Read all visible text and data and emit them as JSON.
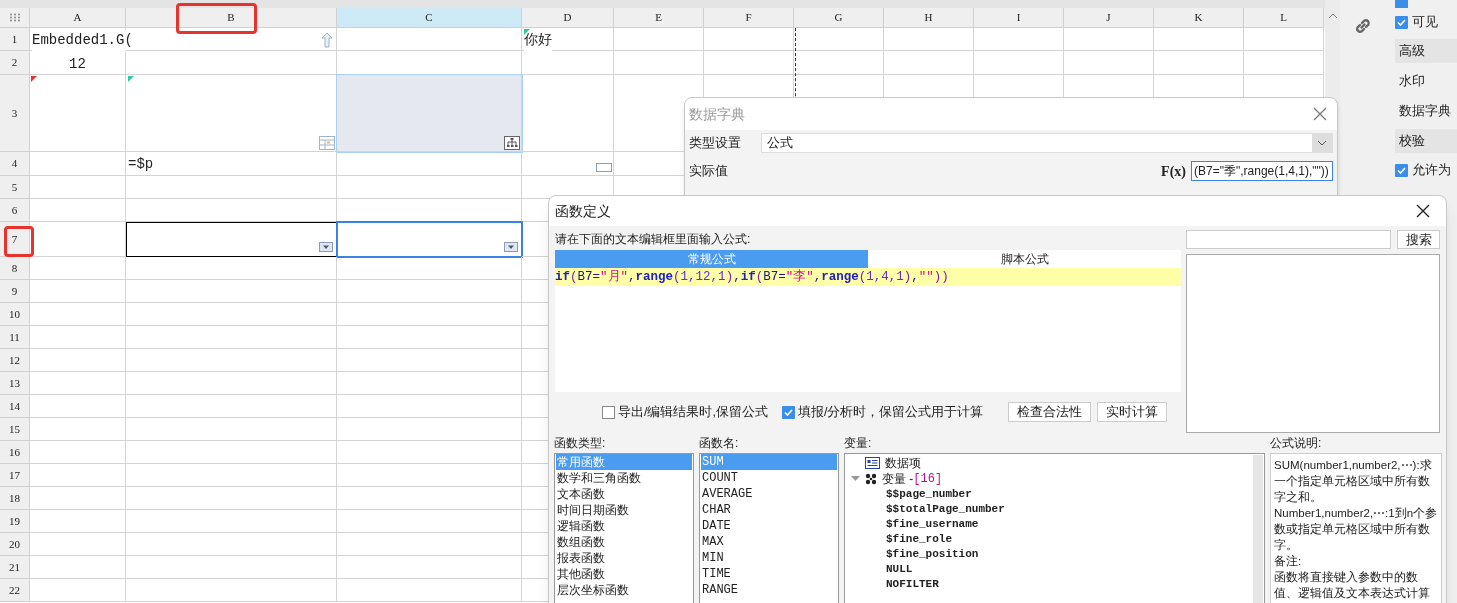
{
  "sheet": {
    "columns": [
      {
        "label": "A",
        "selected": false
      },
      {
        "label": "B",
        "selected": false
      },
      {
        "label": "C",
        "selected": true
      },
      {
        "label": "D",
        "selected": false
      },
      {
        "label": "E",
        "selected": false
      },
      {
        "label": "F",
        "selected": false
      },
      {
        "label": "G",
        "selected": false
      },
      {
        "label": "H",
        "selected": false
      },
      {
        "label": "I",
        "selected": false
      },
      {
        "label": "J",
        "selected": false
      },
      {
        "label": "K",
        "selected": false
      },
      {
        "label": "L",
        "selected": false
      }
    ],
    "rows": [
      {
        "label": "1",
        "cells": [
          {
            "kind": "text",
            "text": "Embedded1.G("
          },
          {
            "kind": "attachment"
          },
          {
            "kind": "blank"
          },
          {
            "kind": "text",
            "text": "你好"
          }
        ]
      },
      {
        "label": "2",
        "cells": [
          {
            "kind": "number",
            "text": "12"
          }
        ]
      },
      {
        "label": "3",
        "cells": [
          {
            "kind": "blank"
          },
          {
            "kind": "subreport"
          },
          {
            "kind": "hierarchy"
          }
        ]
      },
      {
        "label": "4",
        "cells": [
          {
            "kind": "blank"
          },
          {
            "kind": "text",
            "text": "=$p"
          },
          {
            "kind": "blank"
          },
          {
            "kind": "widget"
          }
        ]
      },
      {
        "label": "5"
      },
      {
        "label": "6"
      },
      {
        "label": "7",
        "cells": [
          {
            "kind": "blank"
          },
          {
            "kind": "dropdown",
            "selected": false
          },
          {
            "kind": "dropdown",
            "selected": true
          }
        ]
      },
      {
        "label": "8"
      },
      {
        "label": "9"
      },
      {
        "label": "10"
      },
      {
        "label": "11"
      },
      {
        "label": "12"
      },
      {
        "label": "13"
      },
      {
        "label": "14"
      },
      {
        "label": "15"
      },
      {
        "label": "16"
      },
      {
        "label": "17"
      },
      {
        "label": "18"
      },
      {
        "label": "19"
      },
      {
        "label": "20"
      },
      {
        "label": "21"
      },
      {
        "label": "22"
      }
    ]
  },
  "properties_panel": {
    "items": [
      {
        "kind": "checkbox",
        "label": "可见",
        "checked": true
      },
      {
        "kind": "header",
        "label": "高级"
      },
      {
        "kind": "link",
        "label": "水印"
      },
      {
        "kind": "link",
        "label": "数据字典"
      },
      {
        "kind": "header",
        "label": "校验"
      },
      {
        "kind": "checkbox",
        "label": "允许为",
        "checked": true
      }
    ]
  },
  "data_dictionary_dialog": {
    "title": "数据字典",
    "type_label": "类型设置",
    "type_value": "公式",
    "actual_label": "实际值",
    "fx_label": "F(x)",
    "actual_value": "(B7=\"季\",range(1,4,1),\"\"))"
  },
  "function_dialog": {
    "title": "函数定义",
    "prompt": "请在下面的文本编辑框里面输入公式:",
    "tabs": [
      {
        "label": "常规公式",
        "selected": true
      },
      {
        "label": "脚本公式",
        "selected": false
      }
    ],
    "formula": [
      {
        "kind": "keyword",
        "text": "if"
      },
      {
        "kind": "punct",
        "text": "("
      },
      {
        "kind": "plain",
        "text": "B7="
      },
      {
        "kind": "string",
        "text": "\"月\""
      },
      {
        "kind": "plain",
        "text": ","
      },
      {
        "kind": "keyword",
        "text": "range"
      },
      {
        "kind": "punct",
        "text": "("
      },
      {
        "kind": "number",
        "text": "1,12,1"
      },
      {
        "kind": "punct",
        "text": ")"
      },
      {
        "kind": "plain",
        "text": ","
      },
      {
        "kind": "keyword",
        "text": "if"
      },
      {
        "kind": "punct",
        "text": "("
      },
      {
        "kind": "plain",
        "text": "B7="
      },
      {
        "kind": "string",
        "text": "\"李\""
      },
      {
        "kind": "plain",
        "text": ","
      },
      {
        "kind": "keyword",
        "text": "range"
      },
      {
        "kind": "punct",
        "text": "("
      },
      {
        "kind": "number",
        "text": "1,4,1"
      },
      {
        "kind": "punct",
        "text": ")"
      },
      {
        "kind": "plain",
        "text": ","
      },
      {
        "kind": "string",
        "text": "\"\""
      },
      {
        "kind": "punct",
        "text": "))"
      }
    ],
    "options": [
      {
        "label": "导出/编辑结果时,保留公式",
        "checked": false
      },
      {
        "label": "填报/分析时，保留公式用于计算",
        "checked": true
      }
    ],
    "buttons": [
      "检查合法性",
      "实时计算"
    ],
    "search_button": "搜索",
    "function_types_label": "函数类型:",
    "function_types": [
      {
        "label": "常用函数",
        "selected": true
      },
      {
        "label": "数学和三角函数",
        "selected": false
      },
      {
        "label": "文本函数",
        "selected": false
      },
      {
        "label": "时间日期函数",
        "selected": false
      },
      {
        "label": "逻辑函数",
        "selected": false
      },
      {
        "label": "数组函数",
        "selected": false
      },
      {
        "label": "报表函数",
        "selected": false
      },
      {
        "label": "其他函数",
        "selected": false
      },
      {
        "label": "层次坐标函数",
        "selected": false
      }
    ],
    "function_names_label": "函数名:",
    "function_names": [
      {
        "label": "SUM",
        "selected": true
      },
      {
        "label": "COUNT",
        "selected": false
      },
      {
        "label": "AVERAGE",
        "selected": false
      },
      {
        "label": "CHAR",
        "selected": false
      },
      {
        "label": "DATE",
        "selected": false
      },
      {
        "label": "MAX",
        "selected": false
      },
      {
        "label": "MIN",
        "selected": false
      },
      {
        "label": "TIME",
        "selected": false
      },
      {
        "label": "RANGE",
        "selected": false
      }
    ],
    "variables_label": "变量:",
    "variables": [
      {
        "kind": "dataset",
        "label": "数据项"
      },
      {
        "kind": "group",
        "label": "变量 - ",
        "count": "[16]",
        "expanded": true,
        "children": [
          {
            "label": "$$page_number"
          },
          {
            "label": "$$totalPage_number"
          },
          {
            "label": "$fine_username"
          },
          {
            "label": "$fine_role"
          },
          {
            "label": "$fine_position"
          },
          {
            "label": "NULL"
          },
          {
            "label": "NOFILTER"
          }
        ]
      }
    ],
    "description_label": "公式说明:",
    "description": [
      "SUM(number1,number2,⋯):求一个指定单元格区域中所有数字之和。",
      "Number1,number2,⋯:1到n个参数或指定单元格区域中所有数字。",
      "备注:",
      "函数将直接键入参数中的数值、逻辑值及文本表达式计算"
    ]
  }
}
